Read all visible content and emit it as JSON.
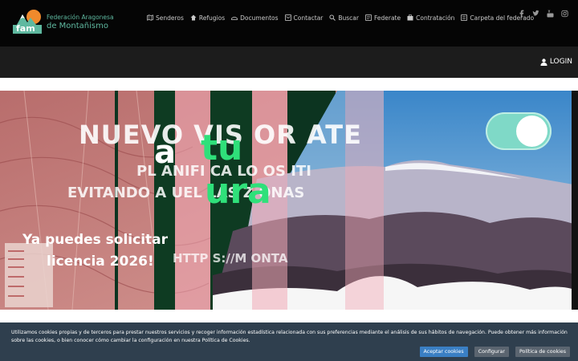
{
  "header": {
    "logo": {
      "abbr": "fam",
      "line1": "Federación Aragonesa",
      "line2": "de Montañismo"
    },
    "nav": [
      {
        "label": "Senderos",
        "icon": "map-icon"
      },
      {
        "label": "Refugios",
        "icon": "refuge-icon"
      },
      {
        "label": "Documentos",
        "icon": "documents-icon"
      },
      {
        "label": "Contactar",
        "icon": "mail-icon"
      },
      {
        "label": "Buscar",
        "icon": "search-icon"
      },
      {
        "label": "Federate",
        "icon": "card-icon"
      },
      {
        "label": "Contratación",
        "icon": "contract-icon"
      },
      {
        "label": "Carpeta del federado",
        "icon": "folder-icon"
      }
    ],
    "social": [
      "facebook-icon",
      "twitter-icon",
      "youtube-icon",
      "instagram-icon"
    ]
  },
  "subbar": {
    "login_label": "LOGIN"
  },
  "hero": {
    "slide_texts": {
      "nuevo": "NUEVO VIS   OR     ATE",
      "sub1": "PL  ANIFI   CA LO   OS ITI",
      "sub2": "EVITANDO A  UEL   LAS Z   ONAS",
      "a": "a",
      "tu": "tu",
      "ventura": "ura",
      "puedes": "Ya puedes solicitar",
      "licencia": "licencia 2026!",
      "url": "HTTP   S://M      ONTA"
    }
  },
  "cookie": {
    "text": "Utilizamos cookies propias y de terceros para prestar nuestros servicios y recoger información estadística relacionada con sus preferencias mediante el análisis de sus hábitos de navegación. Puede obtener más información sobre las cookies, o bien conocer cómo cambiar la configuración en nuestra Política de Cookies.",
    "accept_label": "Aceptar cookies",
    "config_label": "Configurar",
    "policy_label": "Política de cookies"
  },
  "colors": {
    "header_bg": "#050505",
    "subbar_bg": "#1c1c1c",
    "logo_teal": "#5fb9a0",
    "green_text": "#2fe07a",
    "cookie_bg": "#2f3f4e",
    "accept_button": "#3a7fc4"
  }
}
